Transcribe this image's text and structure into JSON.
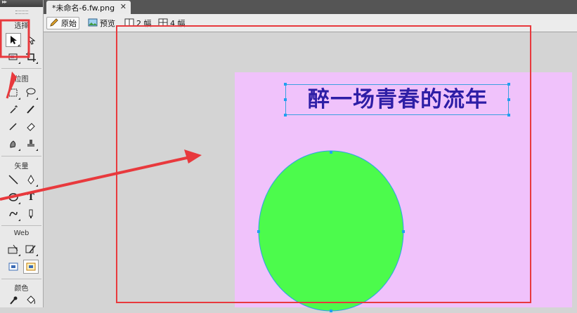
{
  "document_tab": {
    "title": "*未命名-6.fw.png",
    "close_glyph": "✕"
  },
  "view_modes": [
    {
      "label": "原始",
      "icon": "pencil-icon",
      "active": true
    },
    {
      "label": "预览",
      "icon": "preview-image-icon",
      "active": false
    },
    {
      "label": "2 幅",
      "icon": "two-up-icon",
      "active": false
    },
    {
      "label": "4 幅",
      "icon": "four-up-icon",
      "active": false
    }
  ],
  "tools_panel": {
    "sections": [
      {
        "label": "选择"
      },
      {
        "label": "位图"
      },
      {
        "label": "矢量"
      },
      {
        "label": "Web"
      },
      {
        "label": "颜色"
      }
    ],
    "text_tool_glyph": "T"
  },
  "canvas": {
    "background_color": "#f0c2fb",
    "text": "醉一场青春的流年",
    "text_color": "#2e1ea6",
    "circle_fill": "#4cfb4c"
  },
  "annotations": {
    "color": "#e8393d"
  }
}
